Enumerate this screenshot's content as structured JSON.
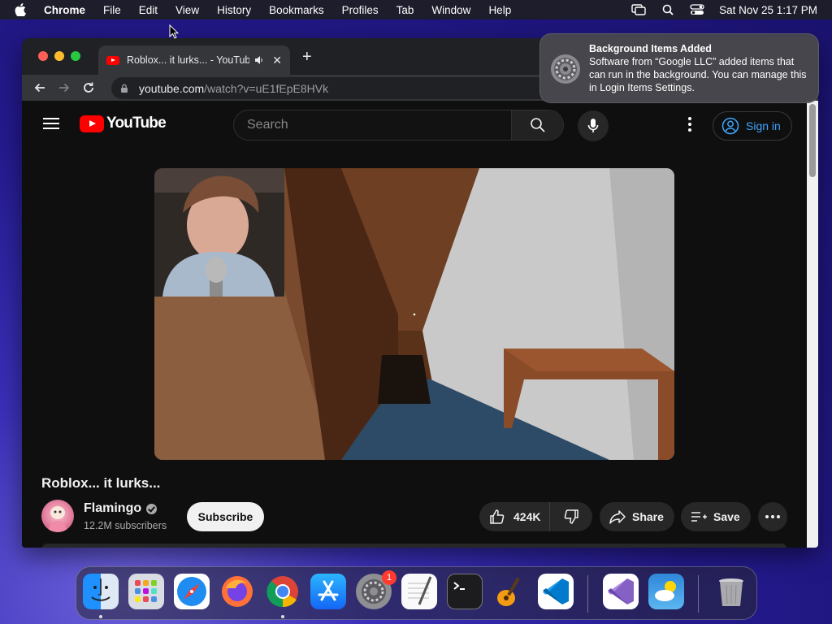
{
  "menubar": {
    "app_name": "Chrome",
    "items": [
      "File",
      "Edit",
      "View",
      "History",
      "Bookmarks",
      "Profiles",
      "Tab",
      "Window",
      "Help"
    ],
    "datetime": "Sat Nov 25  1:17 PM"
  },
  "browser": {
    "tab_title": "Roblox... it lurks... - YouTube",
    "url_host": "youtube.com",
    "url_path": "/watch?v=uE1fEpE8HVk"
  },
  "youtube": {
    "logo_text": "YouTube",
    "search_placeholder": "Search",
    "sign_in": "Sign in",
    "video_title": "Roblox... it lurks...",
    "channel_name": "Flamingo",
    "subscribers": "12.2M subscribers",
    "subscribe_label": "Subscribe",
    "likes": "424K",
    "share_label": "Share",
    "save_label": "Save"
  },
  "notification": {
    "title": "Background Items Added",
    "body": "Software from “Google LLC” added items that can run in the background. You can manage this in Login Items Settings."
  },
  "dock": {
    "apps": [
      "finder-icon",
      "launchpad-icon",
      "safari-icon",
      "firefox-icon",
      "chrome-icon",
      "app-store-icon",
      "system-settings-icon",
      "textedit-icon",
      "terminal-icon",
      "garageband-icon",
      "vscode-icon",
      "visual-studio-icon",
      "weather-icon",
      "trash-icon"
    ],
    "system_settings_badge": "1"
  },
  "colors": {
    "youtube_red": "#ff0000",
    "link_blue": "#3ea6ff",
    "page_bg": "#0f0f0f"
  }
}
